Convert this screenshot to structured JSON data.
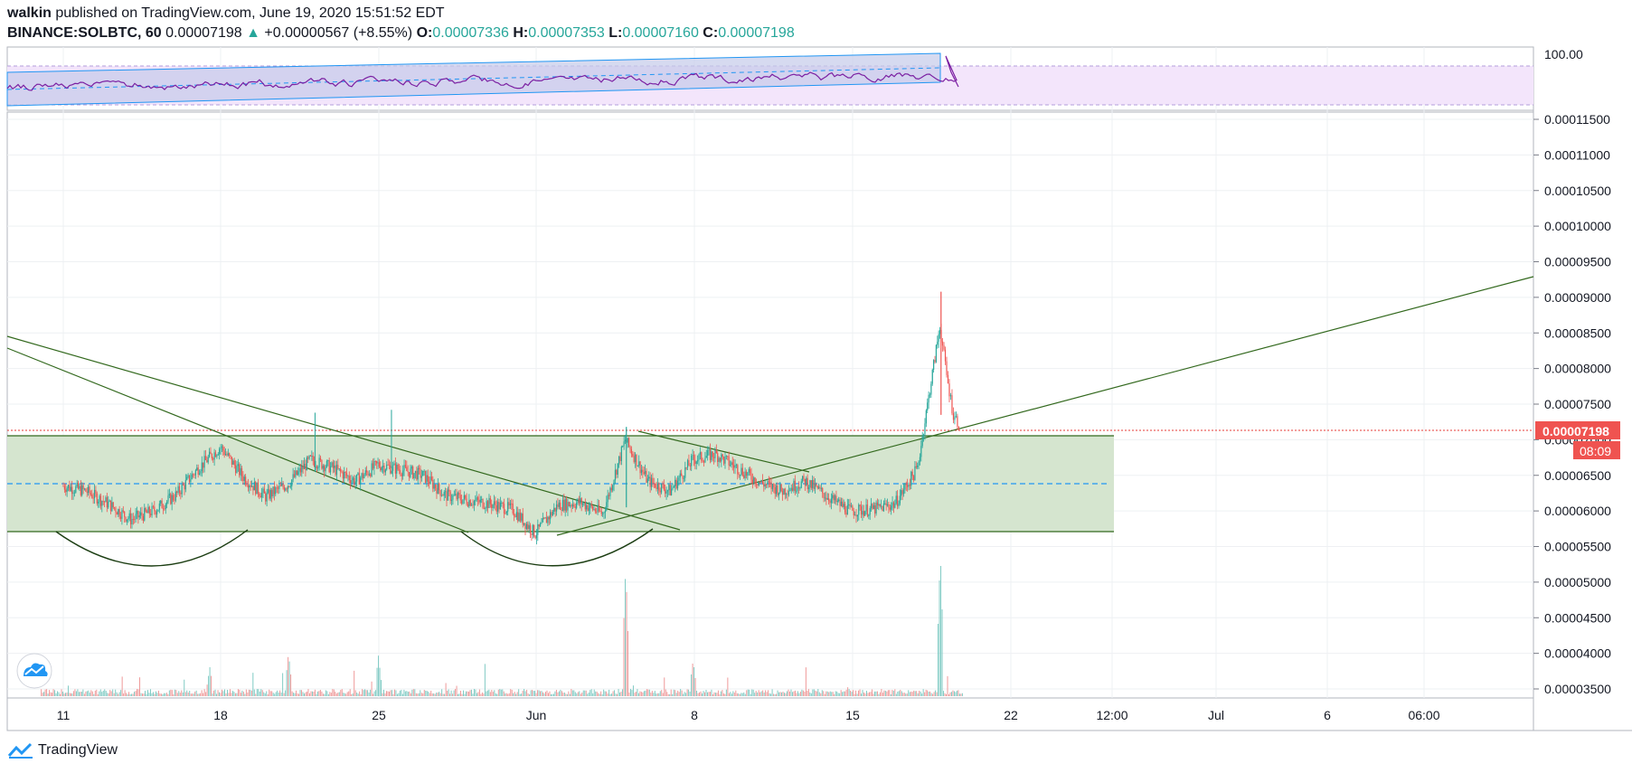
{
  "header": {
    "author": "walkin",
    "published": "published on TradingView.com, June 19, 2020 15:51:52 EDT",
    "symbol": "BINANCE:SOLBTC, 60",
    "close_value": "0.00007198",
    "change": "+0.00000567 (+8.55%)",
    "o_label": "O:",
    "o_value": "0.00007336",
    "h_label": "H:",
    "h_value": "0.00007353",
    "l_label": "L:",
    "l_value": "0.00007160",
    "c_label": "C:",
    "c_value": "0.00007198"
  },
  "footer": {
    "brand": "TradingView"
  },
  "colors": {
    "up": "#26a69a",
    "down": "#ef5350",
    "rsi": "#7b1fa2",
    "trend": "#33691e",
    "zone": "#d5e5cf",
    "dashed": "#2196f3",
    "price_line": "#e53935",
    "channel": "#2196f3",
    "rsi_band": "#f3e5fb"
  },
  "chart_data": {
    "type": "candlestick",
    "symbol": "BINANCE:SOLBTC",
    "interval": "60",
    "ylim": [
      3.4e-05,
      0.00012
    ],
    "price_ticks": [
      "0.00011500",
      "0.00011000",
      "0.00010500",
      "0.00010000",
      "0.00009500",
      "0.00009000",
      "0.00008500",
      "0.00008000",
      "0.00007500",
      "0.00007000",
      "0.00006500",
      "0.00006000",
      "0.00005500",
      "0.00005000",
      "0.00004500",
      "0.00004000",
      "0.00003500"
    ],
    "last_price_label": "0.00007198",
    "countdown_label": "08:09",
    "rsi_tick": "100.00",
    "x_ticks": [
      "11",
      "18",
      "25",
      "Jun",
      "8",
      "15",
      "22",
      "12:00",
      "Jul",
      "6",
      "06:00"
    ],
    "close_path": [
      [
        11,
        6.35e-05
      ],
      [
        12,
        6.28e-05
      ],
      [
        13,
        6.1e-05
      ],
      [
        14,
        5.88e-05
      ],
      [
        15,
        6e-05
      ],
      [
        16,
        6.22e-05
      ],
      [
        17,
        6.6e-05
      ],
      [
        18,
        6.9e-05
      ],
      [
        19,
        6.48e-05
      ],
      [
        20,
        6.2e-05
      ],
      [
        21,
        6.38e-05
      ],
      [
        22,
        6.72e-05
      ],
      [
        23,
        6.6e-05
      ],
      [
        24,
        6.42e-05
      ],
      [
        25,
        6.65e-05
      ],
      [
        26,
        6.58e-05
      ],
      [
        27,
        6.5e-05
      ],
      [
        28,
        6.22e-05
      ],
      [
        29,
        6.15e-05
      ],
      [
        30,
        6.1e-05
      ],
      [
        31,
        6.02e-05
      ],
      [
        32,
        5.68e-05
      ],
      [
        33,
        6.08e-05
      ],
      [
        34,
        6.12e-05
      ],
      [
        35,
        5.96e-05
      ],
      [
        36,
        7e-05
      ],
      [
        37,
        6.42e-05
      ],
      [
        38,
        6.28e-05
      ],
      [
        39,
        6.72e-05
      ],
      [
        40,
        6.8e-05
      ],
      [
        41,
        6.6e-05
      ],
      [
        42,
        6.4e-05
      ],
      [
        43,
        6.28e-05
      ],
      [
        44,
        6.42e-05
      ],
      [
        45,
        6.2e-05
      ],
      [
        46,
        6e-05
      ],
      [
        47,
        6.02e-05
      ],
      [
        48,
        6.1e-05
      ],
      [
        49,
        6.6e-05
      ],
      [
        50,
        8.6e-05
      ],
      [
        50.3,
        7.9e-05
      ],
      [
        50.6,
        7.35e-05
      ],
      [
        50.9,
        7.198e-05
      ]
    ],
    "volume_spikes": [
      [
        36,
        0.9
      ],
      [
        50,
        1.0
      ],
      [
        21,
        0.3
      ],
      [
        25,
        0.28
      ],
      [
        39,
        0.25
      ],
      [
        17.5,
        0.2
      ]
    ],
    "resistance": 7.13e-05,
    "support": 5.74e-05,
    "mid_line": 6.43e-05,
    "annotations": [
      "double-bottom arcs",
      "descending trendlines",
      "ascending trendline",
      "triangle"
    ]
  }
}
